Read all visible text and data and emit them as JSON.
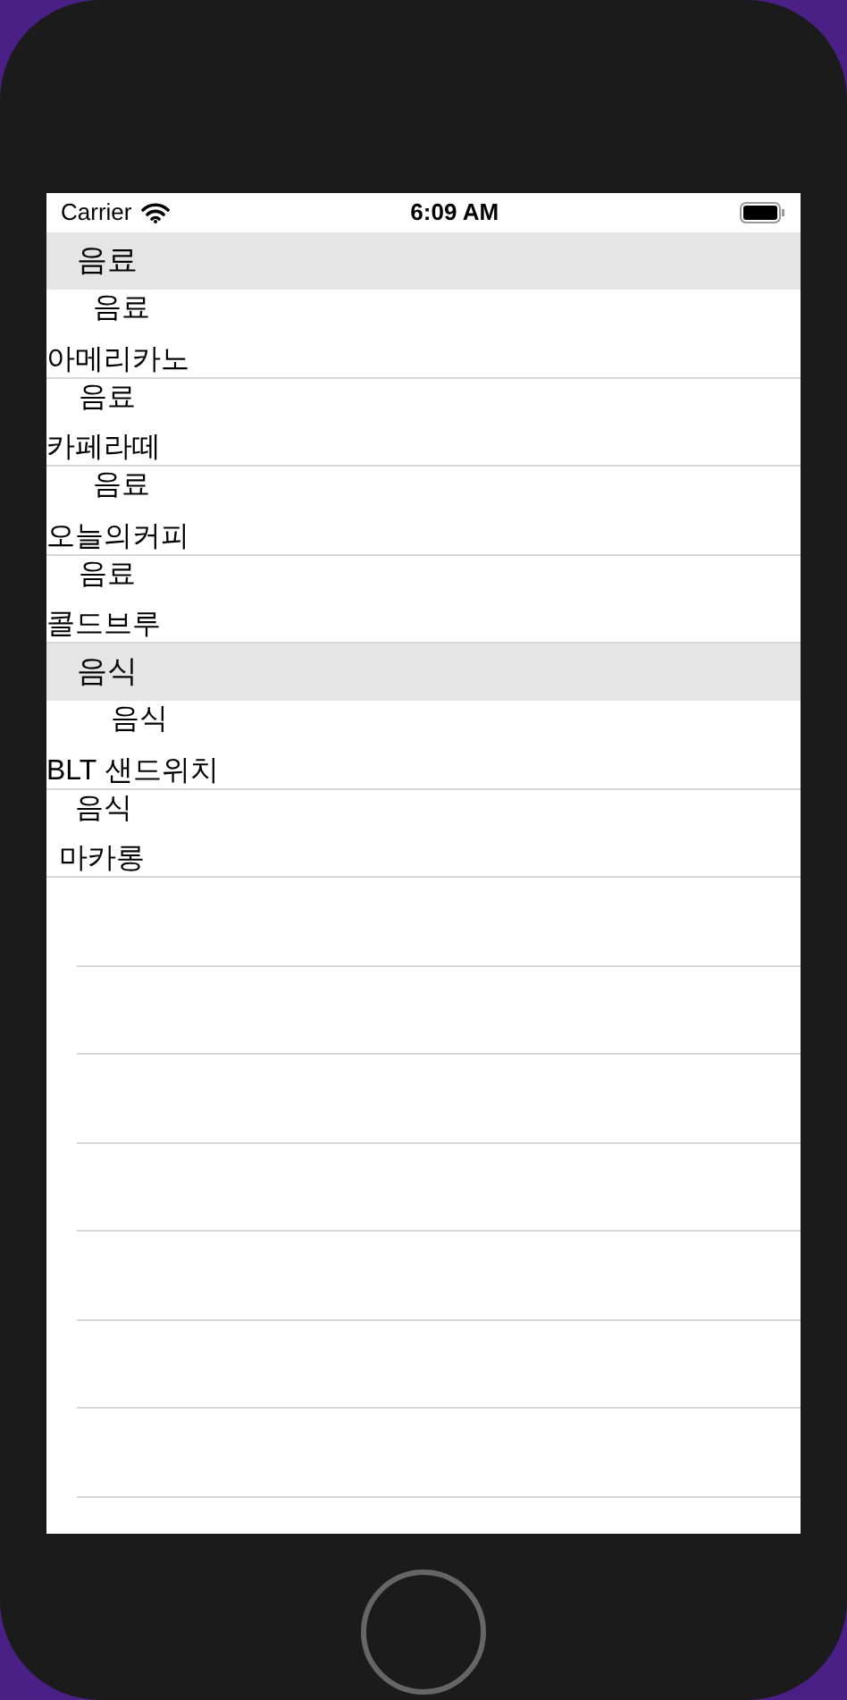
{
  "status_bar": {
    "carrier": "Carrier",
    "time": "6:09 AM"
  },
  "sections": [
    {
      "title": "음료",
      "rows": [
        {
          "category": "음료",
          "name": "아메리카노"
        },
        {
          "category": "음료",
          "name": "카페라떼"
        },
        {
          "category": "음료",
          "name": "오늘의커피"
        },
        {
          "category": "음료",
          "name": "콜드브루"
        }
      ]
    },
    {
      "title": "음식",
      "rows": [
        {
          "category": "음식",
          "name": "BLT 샌드위치"
        },
        {
          "category": "음식",
          "name": "마카롱"
        }
      ]
    }
  ]
}
